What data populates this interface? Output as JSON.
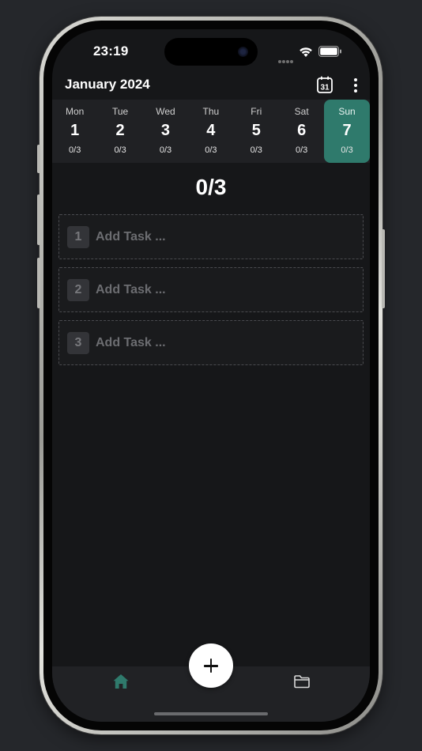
{
  "status_bar": {
    "time": "23:19",
    "icons": [
      "signal-dots-icon",
      "wifi-icon",
      "battery-icon"
    ]
  },
  "header": {
    "month_title": "January 2024",
    "calendar_icon_label": "31",
    "icons": [
      "calendar-icon",
      "more-vertical-icon"
    ]
  },
  "week": {
    "days": [
      {
        "name": "Mon",
        "number": "1",
        "progress": "0/3",
        "selected": false
      },
      {
        "name": "Tue",
        "number": "2",
        "progress": "0/3",
        "selected": false
      },
      {
        "name": "Wed",
        "number": "3",
        "progress": "0/3",
        "selected": false
      },
      {
        "name": "Thu",
        "number": "4",
        "progress": "0/3",
        "selected": false
      },
      {
        "name": "Fri",
        "number": "5",
        "progress": "0/3",
        "selected": false
      },
      {
        "name": "Sat",
        "number": "6",
        "progress": "0/3",
        "selected": false
      },
      {
        "name": "Sun",
        "number": "7",
        "progress": "0/3",
        "selected": true
      }
    ]
  },
  "main": {
    "progress_counter": "0/3",
    "tasks": [
      {
        "index": "1",
        "value": "",
        "placeholder": "Add Task ..."
      },
      {
        "index": "2",
        "value": "",
        "placeholder": "Add Task ..."
      },
      {
        "index": "3",
        "value": "",
        "placeholder": "Add Task ..."
      }
    ]
  },
  "tab_bar": {
    "icons": [
      "home-icon",
      "folder-icon",
      "plus-icon"
    ]
  },
  "colors": {
    "accent": "#2f7a6c",
    "background": "#161719",
    "surface": "#202124"
  }
}
